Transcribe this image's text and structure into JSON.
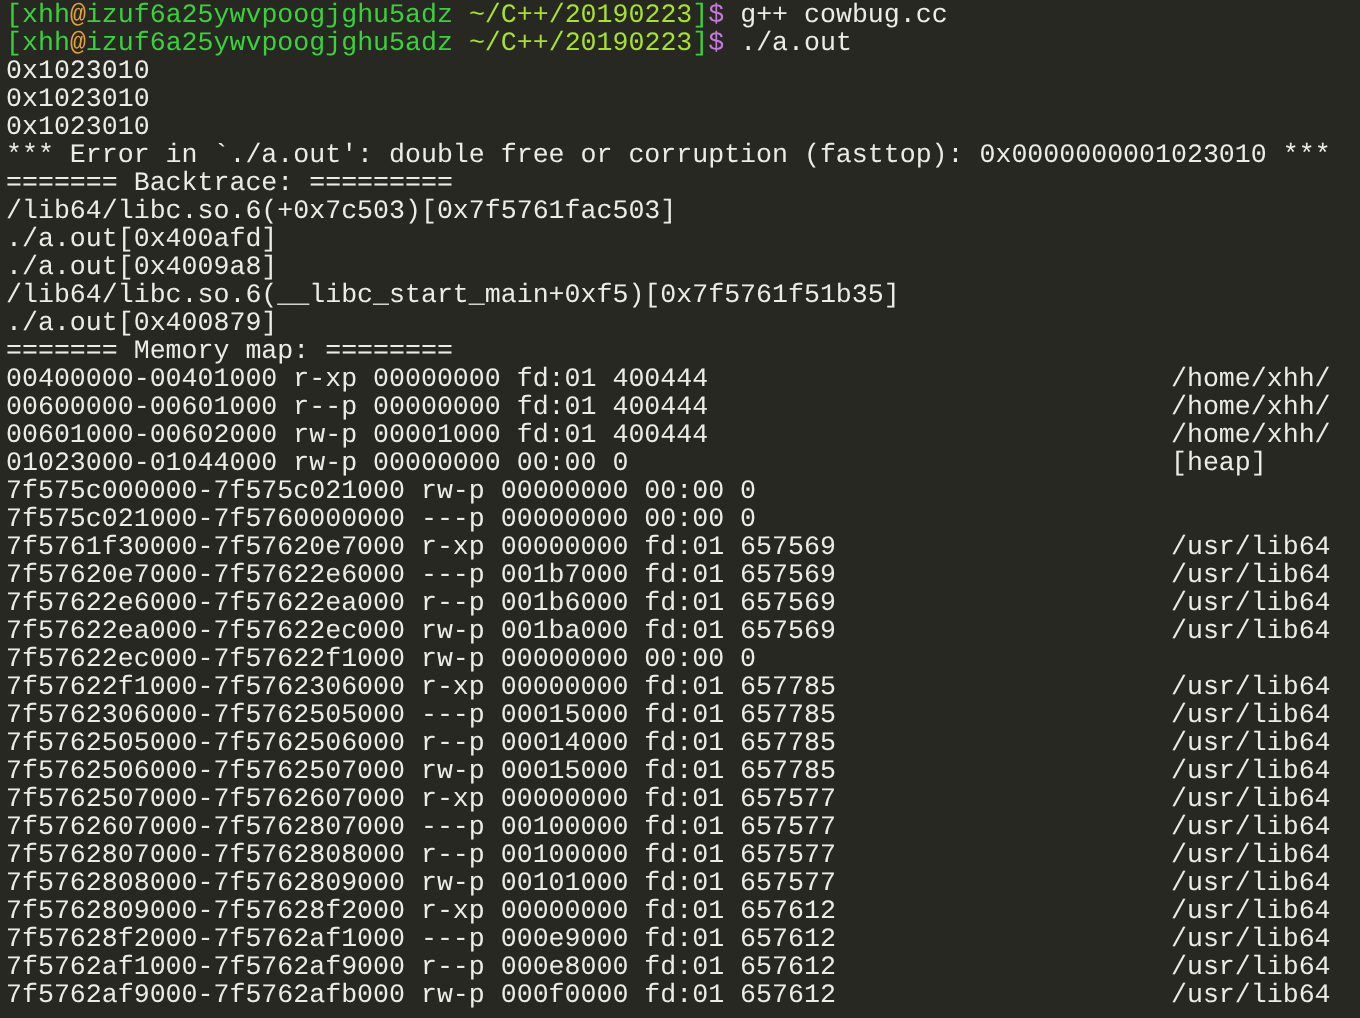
{
  "terminal": {
    "lines": [
      {
        "kind": "prompt",
        "open": "[",
        "user": "xhh",
        "at": "@",
        "host": "izuf6a25ywvpoogjghu5adz",
        "cwd": "~/C++/20190223",
        "close": "]",
        "symbol": "$",
        "command": "g++ cowbug.cc"
      },
      {
        "kind": "prompt",
        "open": "[",
        "user": "xhh",
        "at": "@",
        "host": "izuf6a25ywvpoogjghu5adz",
        "cwd": "~/C++/20190223",
        "close": "]",
        "symbol": "$",
        "command": "./a.out"
      },
      {
        "kind": "output",
        "text": "0x1023010"
      },
      {
        "kind": "output",
        "text": "0x1023010"
      },
      {
        "kind": "output",
        "text": "0x1023010"
      },
      {
        "kind": "output",
        "text": "*** Error in `./a.out': double free or corruption (fasttop): 0x0000000001023010 ***"
      },
      {
        "kind": "output",
        "text": "======= Backtrace: ========="
      },
      {
        "kind": "output",
        "text": "/lib64/libc.so.6(+0x7c503)[0x7f5761fac503]"
      },
      {
        "kind": "output",
        "text": "./a.out[0x400afd]"
      },
      {
        "kind": "output",
        "text": "./a.out[0x4009a8]"
      },
      {
        "kind": "output",
        "text": "/lib64/libc.so.6(__libc_start_main+0xf5)[0x7f5761f51b35]"
      },
      {
        "kind": "output",
        "text": "./a.out[0x400879]"
      },
      {
        "kind": "output",
        "text": "======= Memory map: ========"
      },
      {
        "kind": "map",
        "text": "00400000-00401000 r-xp 00000000 fd:01 400444",
        "path": "/home/xhh/"
      },
      {
        "kind": "map",
        "text": "00600000-00601000 r--p 00000000 fd:01 400444",
        "path": "/home/xhh/"
      },
      {
        "kind": "map",
        "text": "00601000-00602000 rw-p 00001000 fd:01 400444",
        "path": "/home/xhh/"
      },
      {
        "kind": "map",
        "text": "01023000-01044000 rw-p 00000000 00:00 0",
        "path": "[heap]"
      },
      {
        "kind": "map",
        "text": "7f575c000000-7f575c021000 rw-p 00000000 00:00 0"
      },
      {
        "kind": "map",
        "text": "7f575c021000-7f5760000000 ---p 00000000 00:00 0"
      },
      {
        "kind": "map",
        "text": "7f5761f30000-7f57620e7000 r-xp 00000000 fd:01 657569",
        "path": "/usr/lib64"
      },
      {
        "kind": "map",
        "text": "7f57620e7000-7f57622e6000 ---p 001b7000 fd:01 657569",
        "path": "/usr/lib64"
      },
      {
        "kind": "map",
        "text": "7f57622e6000-7f57622ea000 r--p 001b6000 fd:01 657569",
        "path": "/usr/lib64"
      },
      {
        "kind": "map",
        "text": "7f57622ea000-7f57622ec000 rw-p 001ba000 fd:01 657569",
        "path": "/usr/lib64"
      },
      {
        "kind": "map",
        "text": "7f57622ec000-7f57622f1000 rw-p 00000000 00:00 0"
      },
      {
        "kind": "map",
        "text": "7f57622f1000-7f5762306000 r-xp 00000000 fd:01 657785",
        "path": "/usr/lib64"
      },
      {
        "kind": "map",
        "text": "7f5762306000-7f5762505000 ---p 00015000 fd:01 657785",
        "path": "/usr/lib64"
      },
      {
        "kind": "map",
        "text": "7f5762505000-7f5762506000 r--p 00014000 fd:01 657785",
        "path": "/usr/lib64"
      },
      {
        "kind": "map",
        "text": "7f5762506000-7f5762507000 rw-p 00015000 fd:01 657785",
        "path": "/usr/lib64"
      },
      {
        "kind": "map",
        "text": "7f5762507000-7f5762607000 r-xp 00000000 fd:01 657577",
        "path": "/usr/lib64"
      },
      {
        "kind": "map",
        "text": "7f5762607000-7f5762807000 ---p 00100000 fd:01 657577",
        "path": "/usr/lib64"
      },
      {
        "kind": "map",
        "text": "7f5762807000-7f5762808000 r--p 00100000 fd:01 657577",
        "path": "/usr/lib64"
      },
      {
        "kind": "map",
        "text": "7f5762808000-7f5762809000 rw-p 00101000 fd:01 657577",
        "path": "/usr/lib64"
      },
      {
        "kind": "map",
        "text": "7f5762809000-7f57628f2000 r-xp 00000000 fd:01 657612",
        "path": "/usr/lib64"
      },
      {
        "kind": "map",
        "text": "7f57628f2000-7f5762af1000 ---p 000e9000 fd:01 657612",
        "path": "/usr/lib64"
      },
      {
        "kind": "map",
        "text": "7f5762af1000-7f5762af9000 r--p 000e8000 fd:01 657612",
        "path": "/usr/lib64"
      },
      {
        "kind": "map",
        "text": "7f5762af9000-7f5762afb000 rw-p 000f0000 fd:01 657612",
        "path": "/usr/lib64"
      }
    ]
  }
}
